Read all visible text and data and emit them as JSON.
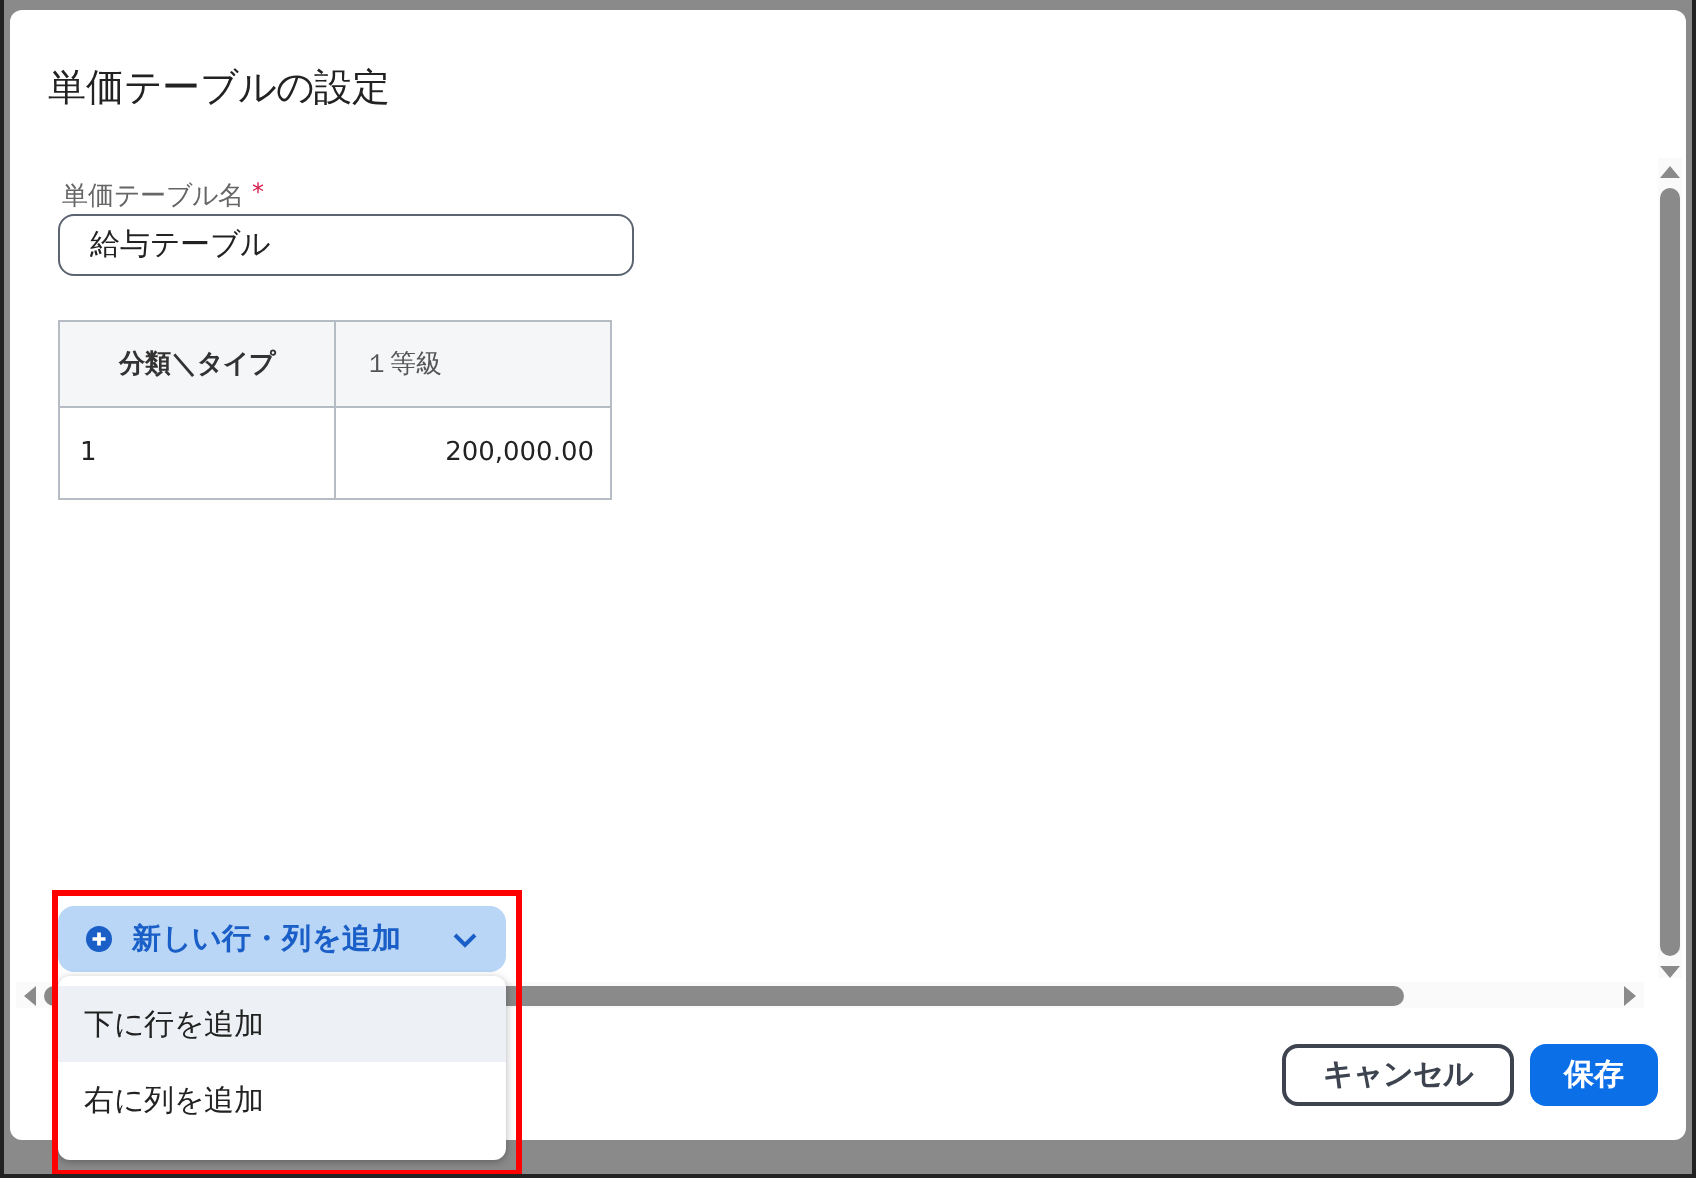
{
  "dialog": {
    "title": "単価テーブルの設定"
  },
  "name_field": {
    "label": "単価テーブル名",
    "required_mark": "*",
    "value": "給与テーブル"
  },
  "table": {
    "columns": [
      "分類＼タイプ",
      "１等級"
    ],
    "rows": [
      [
        "1",
        "200,000.00"
      ]
    ]
  },
  "add_menu": {
    "button": "新しい行・列を追加",
    "expanded": true,
    "items": [
      {
        "label": "下に行を追加",
        "selected": true
      },
      {
        "label": "右に列を追加",
        "selected": false
      }
    ]
  },
  "buttons": [
    {
      "label": "キャンセル",
      "kind": "secondary"
    },
    {
      "label": "保存",
      "kind": "primary"
    }
  ]
}
